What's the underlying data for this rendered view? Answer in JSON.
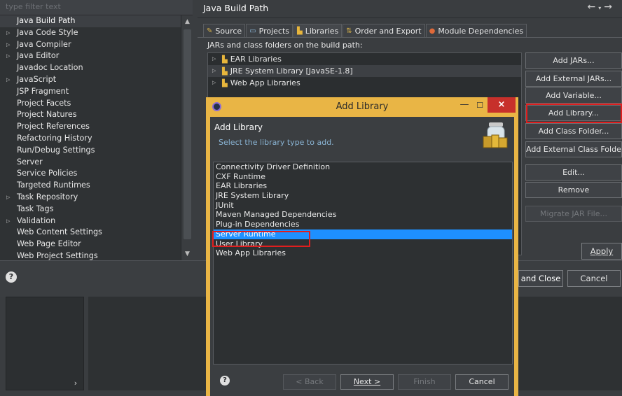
{
  "filter": {
    "placeholder": "type filter text"
  },
  "left_tree": {
    "items": [
      {
        "label": "Java Build Path",
        "expandable": false,
        "selected": true
      },
      {
        "label": "Java Code Style",
        "expandable": true
      },
      {
        "label": "Java Compiler",
        "expandable": true
      },
      {
        "label": "Java Editor",
        "expandable": true
      },
      {
        "label": "Javadoc Location",
        "expandable": false
      },
      {
        "label": "JavaScript",
        "expandable": true
      },
      {
        "label": "JSP Fragment",
        "expandable": false
      },
      {
        "label": "Project Facets",
        "expandable": false
      },
      {
        "label": "Project Natures",
        "expandable": false
      },
      {
        "label": "Project References",
        "expandable": false
      },
      {
        "label": "Refactoring History",
        "expandable": false
      },
      {
        "label": "Run/Debug Settings",
        "expandable": false
      },
      {
        "label": "Server",
        "expandable": false
      },
      {
        "label": "Service Policies",
        "expandable": false
      },
      {
        "label": "Targeted Runtimes",
        "expandable": false
      },
      {
        "label": "Task Repository",
        "expandable": true
      },
      {
        "label": "Task Tags",
        "expandable": false
      },
      {
        "label": "Validation",
        "expandable": true
      },
      {
        "label": "Web Content Settings",
        "expandable": false
      },
      {
        "label": "Web Page Editor",
        "expandable": false
      },
      {
        "label": "Web Project Settings",
        "expandable": false
      }
    ]
  },
  "page": {
    "title": "Java Build Path"
  },
  "tabs": [
    {
      "label": "Source",
      "icon": "source-icon",
      "active": false
    },
    {
      "label": "Projects",
      "icon": "projects-icon",
      "active": false
    },
    {
      "label": "Libraries",
      "icon": "libraries-icon",
      "active": true
    },
    {
      "label": "Order and Export",
      "icon": "order-icon",
      "active": false
    },
    {
      "label": "Module Dependencies",
      "icon": "module-icon",
      "active": false
    }
  ],
  "classpath": {
    "label": "JARs and class folders on the build path:",
    "items": [
      {
        "label": "EAR Libraries"
      },
      {
        "label": "JRE System Library [JavaSE-1.8]"
      },
      {
        "label": "Web App Libraries"
      }
    ]
  },
  "side_buttons": [
    {
      "label": "Add JARs...",
      "disabled": false
    },
    {
      "label": "Add External JARs...",
      "disabled": false
    },
    {
      "label": "Add Variable...",
      "disabled": false
    },
    {
      "label": "Add Library...",
      "disabled": false
    },
    {
      "label": "Add Class Folder...",
      "disabled": false
    },
    {
      "label": "Add External Class Folder...",
      "disabled": false
    },
    {
      "label": "Edit...",
      "disabled": false
    },
    {
      "label": "Remove",
      "disabled": false
    },
    {
      "label": "Migrate JAR File...",
      "disabled": true
    }
  ],
  "apply_label": "Apply",
  "apply_close_label": "and Close",
  "cancel_label": "Cancel",
  "dialog": {
    "title": "Add Library",
    "header_title": "Add Library",
    "header_subtitle": "Select the library type to add.",
    "close_glyph": "×",
    "min_glyph": "—",
    "max_glyph": "☐",
    "items": [
      "Connectivity Driver Definition",
      "CXF Runtime",
      "EAR Libraries",
      "JRE System Library",
      "JUnit",
      "Maven Managed Dependencies",
      "Plug-in Dependencies",
      "Server Runtime",
      "User Library",
      "Web App Libraries"
    ],
    "selected_index": 7,
    "back_label": "< Back",
    "next_label": "Next >",
    "finish_label": "Finish",
    "cancel_label": "Cancel"
  },
  "colors": {
    "dialog_frame": "#e9b545",
    "selection": "#1e90ff",
    "highlight": "#e01e1e"
  }
}
